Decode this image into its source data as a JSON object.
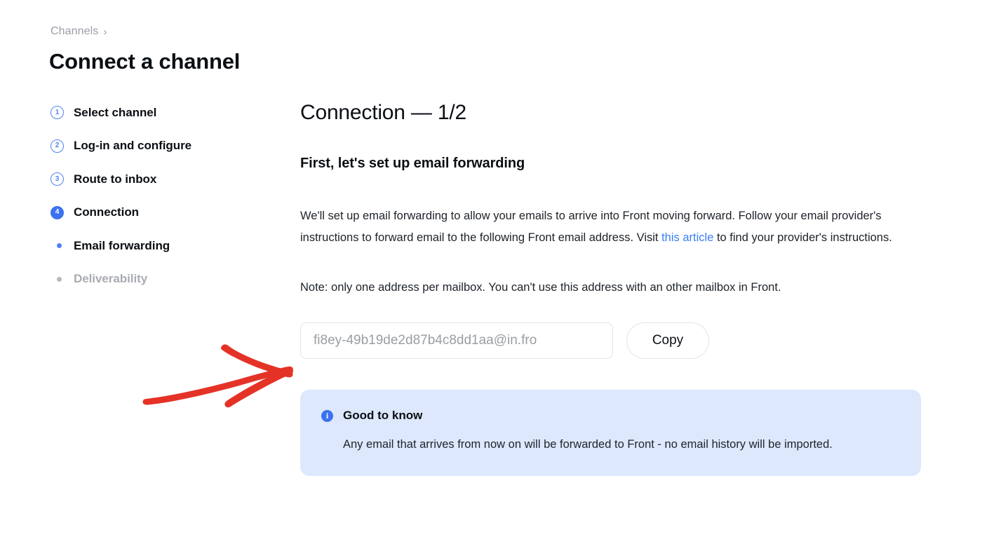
{
  "breadcrumb": {
    "items": [
      "Channels"
    ],
    "separator": "›"
  },
  "page_title": "Connect a channel",
  "stepper": {
    "steps": [
      {
        "number": "1",
        "label": "Select channel",
        "state": "pending"
      },
      {
        "number": "2",
        "label": "Log-in and configure",
        "state": "pending"
      },
      {
        "number": "3",
        "label": "Route to inbox",
        "state": "pending"
      },
      {
        "number": "4",
        "label": "Connection",
        "state": "current"
      }
    ],
    "substeps": [
      {
        "label": "Email forwarding",
        "state": "active"
      },
      {
        "label": "Deliverability",
        "state": "muted"
      }
    ]
  },
  "content": {
    "section_title": "Connection — 1/2",
    "section_subtitle": "First, let's set up email forwarding",
    "paragraph_1_before_link": "We'll set up email forwarding to allow your emails to arrive into Front moving forward. Follow your email provider's instructions to forward email to the following Front email address. Visit ",
    "paragraph_1_link": "this article",
    "paragraph_1_after_link": " to find your provider's instructions.",
    "paragraph_2": "Note: only one address per mailbox. You can't use this address with an other mailbox in Front.",
    "email_value": "fi8ey-49b19de2d87b4c8dd1aa@in.fro",
    "email_placeholder": "fi8ey-49b19de2d87b4c8dd1aa@in.fro",
    "copy_label": "Copy"
  },
  "callout": {
    "icon": "info-icon",
    "title": "Good to know",
    "body": "Any email that arrives from now on will be forwarded to Front - no email history will be imported."
  },
  "annotation": {
    "type": "arrow",
    "direction": "right",
    "color": "#e53227"
  },
  "colors": {
    "accent_blue": "#3b72ef",
    "link_blue": "#3b7ef5",
    "callout_bg": "#dde8fd",
    "muted_text": "#a8acb2",
    "annotation_red": "#e53227"
  }
}
